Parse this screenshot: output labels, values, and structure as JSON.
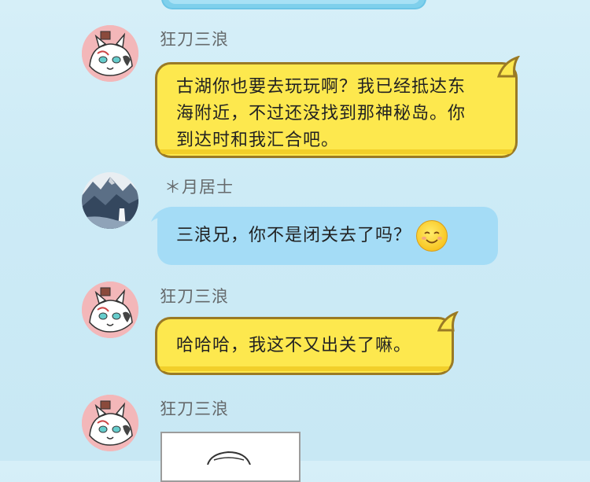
{
  "messages": [
    {
      "sender": "狂刀三浪",
      "avatar_icon": "cat-avatar-icon",
      "bubble_color": "#fde84e",
      "text": "古湖你也要去玩玩啊？我已经抵达东海附近，不过还没找到那神秘岛。你到达时和我汇合吧。",
      "lines": [
        "古湖你也要去玩玩啊？我已经抵达东",
        "海附近，不过还没找到那神秘岛。你",
        "到达时和我汇合吧。"
      ]
    },
    {
      "sender": "＊月居士",
      "avatar_icon": "mountain-landscape-avatar-icon",
      "bubble_color": "#a4dcf6",
      "text": "三浪兄，你不是闭关去了吗？",
      "emoji_icon": "smile-emoji-icon"
    },
    {
      "sender": "狂刀三浪",
      "avatar_icon": "cat-avatar-icon",
      "bubble_color": "#fde84e",
      "text": "哈哈哈，我这不又出关了嘛。"
    },
    {
      "sender": "狂刀三浪",
      "avatar_icon": "cat-avatar-icon",
      "content_icon": "sketch-image-icon"
    }
  ]
}
